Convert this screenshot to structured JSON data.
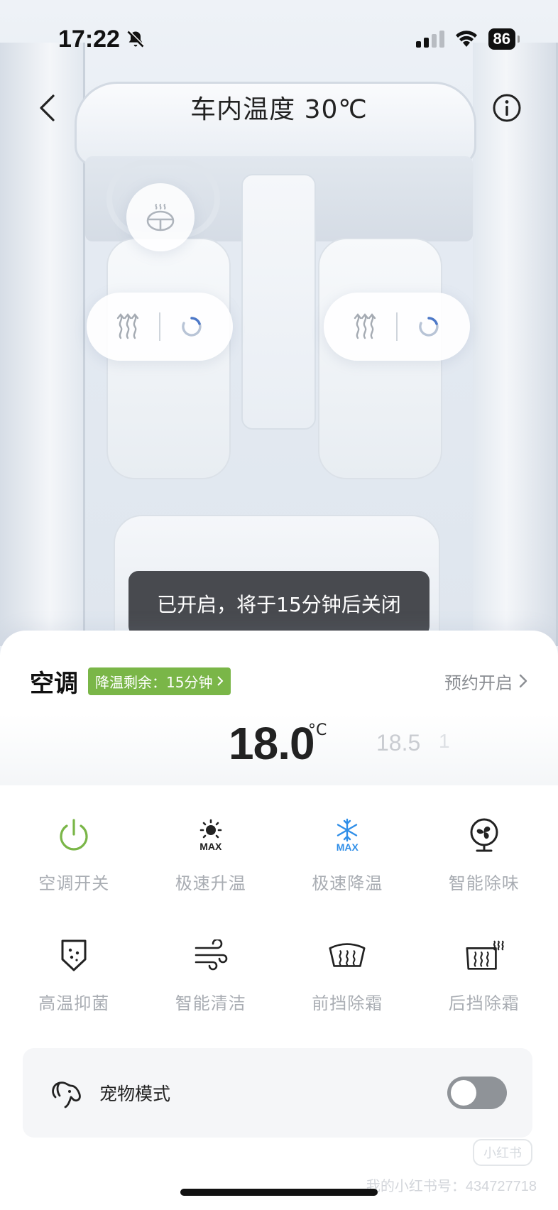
{
  "status_bar": {
    "time": "17:22",
    "battery": "86",
    "icons": [
      "bell-slash-icon",
      "signal-icon",
      "wifi-icon",
      "battery-icon"
    ]
  },
  "header": {
    "title": "车内温度 30℃",
    "back_icon": "chevron-left-icon",
    "info_icon": "info-icon"
  },
  "floating_controls": {
    "steering_heat_icon": "steering-wheel-heat-icon",
    "seat_heat_icon": "seat-heat-icon",
    "seat_vent_icon": "seat-vent-icon"
  },
  "toast": {
    "text": "已开启，将于15分钟后关闭"
  },
  "panel": {
    "title": "空调",
    "badge": "降温剩余：15分钟",
    "schedule_link": "预约开启",
    "temperature": {
      "current": "18.0",
      "unit": "°C",
      "next": "18.5",
      "next2": "1"
    },
    "functions": [
      {
        "label": "空调开关",
        "icon": "power-icon"
      },
      {
        "label": "极速升温",
        "icon": "sun-max-icon"
      },
      {
        "label": "极速降温",
        "icon": "snowflake-max-icon"
      },
      {
        "label": "智能除味",
        "icon": "fan-icon"
      },
      {
        "label": "高温抑菌",
        "icon": "shield-dots-icon"
      },
      {
        "label": "智能清洁",
        "icon": "wind-icon"
      },
      {
        "label": "前挡除霜",
        "icon": "front-defrost-icon"
      },
      {
        "label": "后挡除霜",
        "icon": "rear-defrost-icon"
      }
    ],
    "max_label": "MAX",
    "pet_mode": {
      "label": "宠物模式",
      "icon": "dog-icon",
      "enabled": false
    }
  },
  "watermark": {
    "logo": "小红书",
    "text": "我的小红书号：434727718"
  },
  "colors": {
    "accent_green": "#7ab648",
    "accent_blue": "#2f8ee8",
    "label_gray": "#a9adb3",
    "toast_bg": "#3a3c40"
  }
}
